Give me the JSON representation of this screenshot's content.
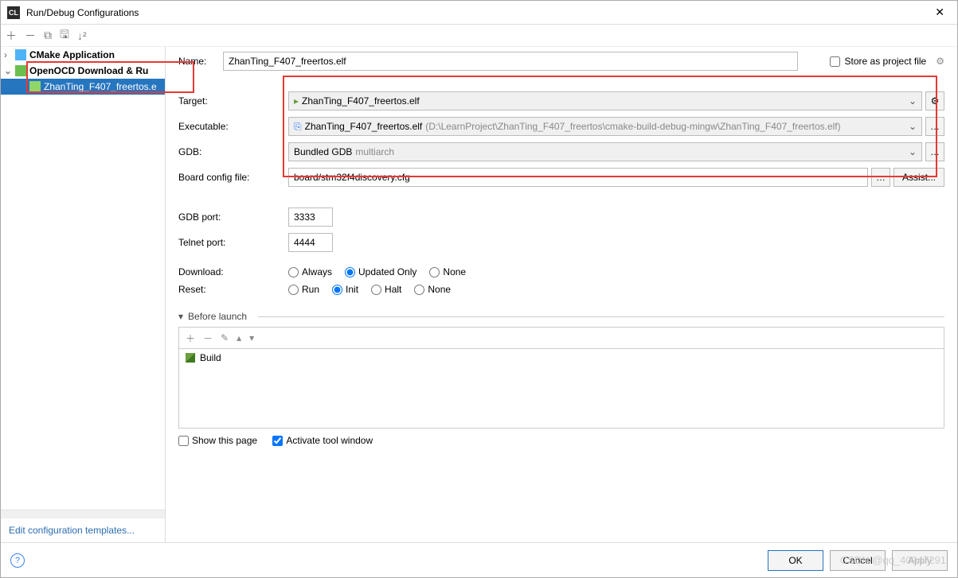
{
  "window": {
    "title": "Run/Debug Configurations"
  },
  "sidebar": {
    "nodes": {
      "cmake": "CMake Application",
      "openocd": "OpenOCD Download & Ru",
      "selected": "ZhanTing_F407_freertos.e"
    },
    "edit_templates": "Edit configuration templates..."
  },
  "form": {
    "name_label": "Name:",
    "name_value": "ZhanTing_F407_freertos.elf",
    "store_label": "Store as project file",
    "target_label": "Target:",
    "target_value": "ZhanTing_F407_freertos.elf",
    "exe_label": "Executable:",
    "exe_value": "ZhanTing_F407_freertos.elf",
    "exe_hint": "(D:\\LearnProject\\ZhanTing_F407_freertos\\cmake-build-debug-mingw\\ZhanTing_F407_freertos.elf)",
    "gdb_label": "GDB:",
    "gdb_value": "Bundled GDB",
    "gdb_hint": "multiarch",
    "board_label": "Board config file:",
    "board_value": "board/stm32f4discovery.cfg",
    "assist": "Assist...",
    "gdb_port_label": "GDB port:",
    "gdb_port": "3333",
    "telnet_label": "Telnet port:",
    "telnet_port": "4444",
    "download_label": "Download:",
    "download_opts": {
      "always": "Always",
      "updated": "Updated Only",
      "none": "None"
    },
    "reset_label": "Reset:",
    "reset_opts": {
      "run": "Run",
      "init": "Init",
      "halt": "Halt",
      "none": "None"
    },
    "before_launch": "Before launch",
    "build_item": "Build",
    "show_page": "Show this page",
    "activate_tool": "Activate tool window"
  },
  "footer": {
    "ok": "OK",
    "cancel": "Cancel",
    "apply": "Apply"
  },
  "watermark": "CSDN @qq_40947291"
}
